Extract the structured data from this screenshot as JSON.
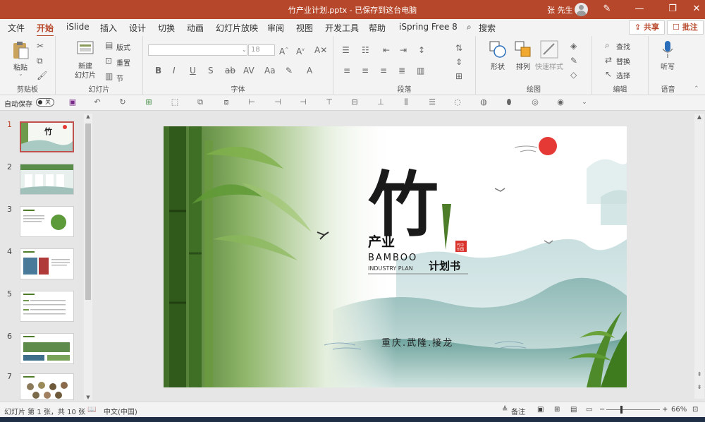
{
  "window": {
    "title": "竹产业计划.pptx - 已保存到这台电脑",
    "user": "张 先生"
  },
  "tabs": [
    "文件",
    "开始",
    "iSlide",
    "插入",
    "设计",
    "切换",
    "动画",
    "幻灯片放映",
    "审阅",
    "视图",
    "开发工具",
    "帮助",
    "iSpring Free 8",
    "搜索"
  ],
  "active_tab": "开始",
  "actions": {
    "share": "共享",
    "comment": "批注"
  },
  "ribbon": {
    "clipboard": {
      "label": "剪贴板",
      "paste": "粘贴"
    },
    "slides": {
      "label": "幻灯片",
      "new_slide_line1": "新建",
      "new_slide_line2": "幻灯片",
      "layout": "版式",
      "reset": "重置",
      "section": "节"
    },
    "font": {
      "label": "字体",
      "size": "18"
    },
    "paragraph": {
      "label": "段落"
    },
    "drawing": {
      "label": "绘图",
      "shapes": "形状",
      "arrange": "排列",
      "quick_styles": "快速样式"
    },
    "editing": {
      "label": "编辑",
      "find": "查找",
      "replace": "替换",
      "select": "选择"
    },
    "voice": {
      "label": "语音",
      "dictate": "听写"
    }
  },
  "qat": {
    "autosave": "自动保存",
    "autosave_state": "关"
  },
  "thumbnails": [
    {
      "num": "1",
      "selected": true
    },
    {
      "num": "2",
      "selected": false
    },
    {
      "num": "3",
      "selected": false
    },
    {
      "num": "4",
      "selected": false
    },
    {
      "num": "5",
      "selected": false
    },
    {
      "num": "6",
      "selected": false
    },
    {
      "num": "7",
      "selected": false
    }
  ],
  "slide": {
    "big_char": "竹",
    "line1": "产业",
    "line2": "BAMBOO",
    "line3": "INDUSTRY PLAN",
    "line4": "计划书",
    "seal": "竹印 中国",
    "location": "重庆.武隆.接龙"
  },
  "status": {
    "slide_info": "幻灯片 第 1 张，共 10 张",
    "language": "中文(中国)",
    "notes": "备注",
    "zoom": "66%"
  },
  "colors": {
    "accent": "#b7472a",
    "bamboo_green": "#4e7d2a",
    "sun_red": "#e53935"
  }
}
